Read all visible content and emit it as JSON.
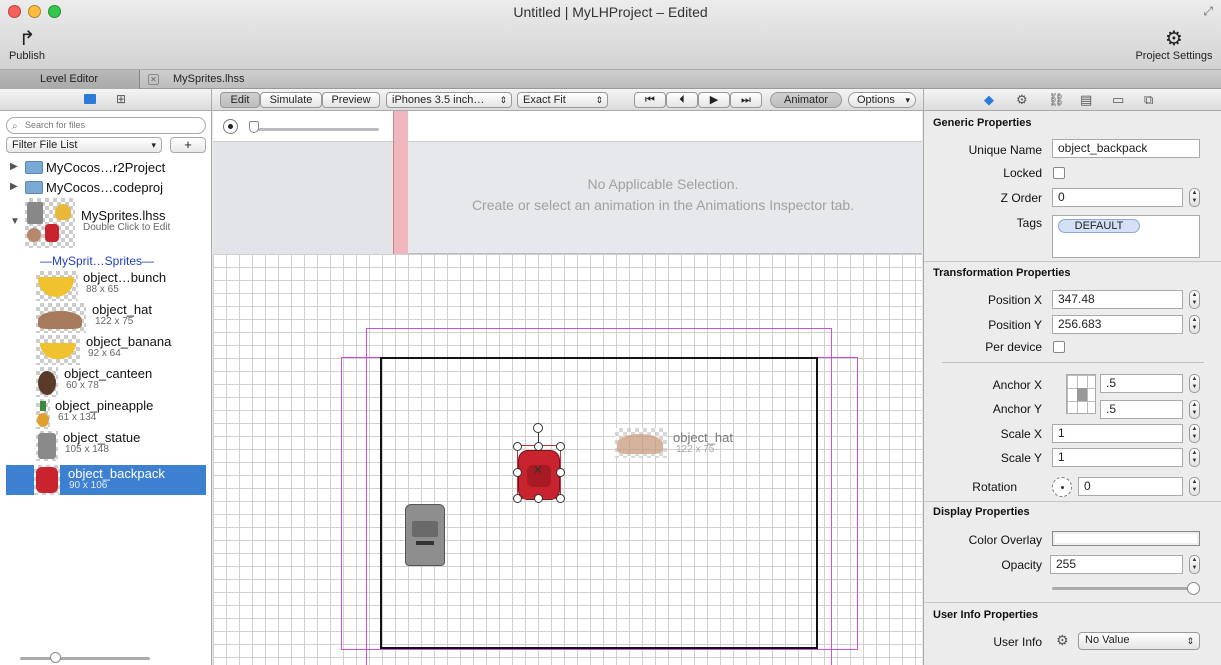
{
  "window": {
    "title": "Untitled | MyLHProject – Edited"
  },
  "toolbar": {
    "publish_label": "Publish",
    "project_settings_label": "Project Settings"
  },
  "tabs": [
    {
      "label": "Level Editor"
    },
    {
      "label": "MySprites.lhss"
    }
  ],
  "left_panel": {
    "search_placeholder": "Search for files",
    "filter_label": "Filter File List",
    "add_label": "+",
    "tree": [
      {
        "label": "MyCocos…r2Project"
      },
      {
        "label": "MyCocos…codeproj"
      },
      {
        "label": "MySprites.lhss",
        "sub": "Double Click to Edit"
      }
    ],
    "sheet_label": "—MySprit…Sprites—",
    "sprites": [
      {
        "name": "object…bunch",
        "size": "88 x 65"
      },
      {
        "name": "object_hat",
        "size": "122 x 75"
      },
      {
        "name": "object_banana",
        "size": "92 x 64"
      },
      {
        "name": "object_canteen",
        "size": "60 x 78"
      },
      {
        "name": "object_pineapple",
        "size": "61 x 134"
      },
      {
        "name": "object_statue",
        "size": "105 x 148"
      },
      {
        "name": "object_backpack",
        "size": "90 x 106"
      }
    ]
  },
  "center_toolbar": {
    "edit": "Edit",
    "simulate": "Simulate",
    "preview": "Preview",
    "device": "iPhones 3.5 inch…",
    "fit": "Exact Fit",
    "animator": "Animator",
    "options": "Options"
  },
  "animation": {
    "no_selection": "No Applicable Selection.",
    "hint": "Create or select an animation in the Animations Inspector tab."
  },
  "canvas": {
    "hat_label": "object_hat",
    "hat_size": "122 x 75"
  },
  "inspector": {
    "generic_title": "Generic Properties",
    "unique_name_label": "Unique Name",
    "unique_name_value": "object_backpack",
    "locked_label": "Locked",
    "z_order_label": "Z Order",
    "z_order_value": "0",
    "tags_label": "Tags",
    "tag_value": "DEFAULT",
    "transform_title": "Transformation Properties",
    "pos_x_label": "Position X",
    "pos_x_value": "347.48",
    "pos_y_label": "Position Y",
    "pos_y_value": "256.683",
    "per_device_label": "Per device",
    "anchor_x_label": "Anchor X",
    "anchor_x_value": ".5",
    "anchor_y_label": "Anchor Y",
    "anchor_y_value": ".5",
    "scale_x_label": "Scale X",
    "scale_x_value": "1",
    "scale_y_label": "Scale Y",
    "scale_y_value": "1",
    "rotation_label": "Rotation",
    "rotation_value": "0",
    "display_title": "Display Properties",
    "color_overlay_label": "Color Overlay",
    "opacity_label": "Opacity",
    "opacity_value": "255",
    "user_info_title": "User Info Properties",
    "user_info_label": "User Info",
    "user_info_value": "No Value"
  },
  "colors": {
    "accent": "#3d7fd1",
    "selection_red": "#c0303a",
    "magenta": "#d04fd6"
  }
}
